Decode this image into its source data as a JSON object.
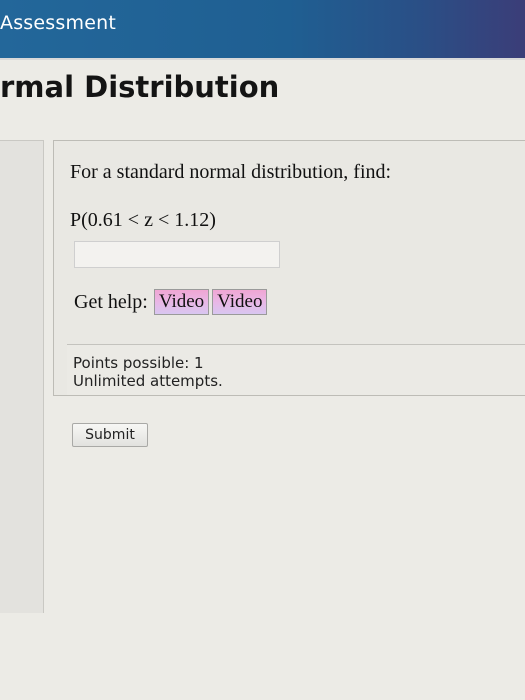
{
  "header": {
    "title": "Assessment"
  },
  "page": {
    "title": "rmal Distribution"
  },
  "question": {
    "prompt": "For a standard normal distribution, find:",
    "expression": "P(0.61 < z < 1.12)",
    "answer_value": "",
    "help_label": "Get help:",
    "help_buttons": [
      {
        "label": "Video"
      },
      {
        "label": "Video"
      }
    ],
    "points_possible": "Points possible: 1",
    "attempts": "Unlimited attempts."
  },
  "actions": {
    "submit_label": "Submit"
  },
  "colors": {
    "header_bg": "#1f5f92",
    "page_bg": "#ecebe6",
    "video_button_pink": "#f0a6d3"
  }
}
